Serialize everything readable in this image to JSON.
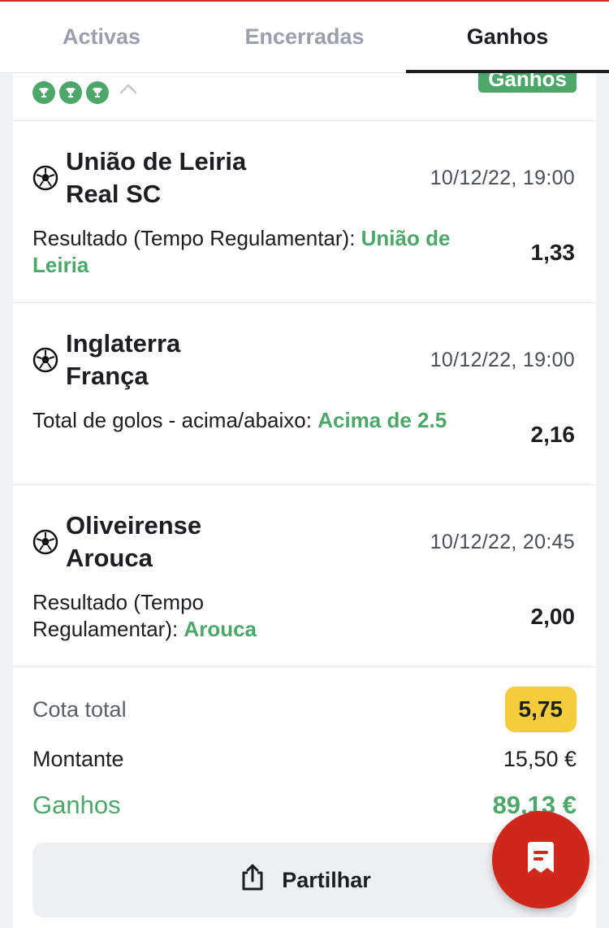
{
  "tabs": [
    {
      "label": "Activas"
    },
    {
      "label": "Encerradas"
    },
    {
      "label": "Ganhos",
      "active": true
    }
  ],
  "bet": {
    "status_badge": "Ganhos",
    "trophy_icons": [
      "trophy-icon",
      "trophy-icon",
      "trophy-icon"
    ],
    "events": [
      {
        "team_home": "União de Leiria",
        "team_away": "Real SC",
        "datetime": "10/12/22, 19:00",
        "market": "Resultado (Tempo Regulamentar): ",
        "pick": "União de Leiria",
        "odd": "1,33"
      },
      {
        "team_home": "Inglaterra",
        "team_away": "França",
        "datetime": "10/12/22, 19:00",
        "market": "Total de golos - acima/abaixo: ",
        "pick": "Acima de 2.5",
        "odd": "2,16"
      },
      {
        "team_home": "Oliveirense",
        "team_away": "Arouca",
        "datetime": "10/12/22, 20:45",
        "market": "Resultado (Tempo Regulamentar): ",
        "pick": "Arouca",
        "odd": "2,00"
      }
    ],
    "summary": {
      "total_odd_label": "Cota total",
      "total_odd_value": "5,75",
      "stake_label": "Montante",
      "stake_value": "15,50 €",
      "winnings_label": "Ganhos",
      "winnings_value": "89,13 €"
    },
    "share_label": "Partilhar"
  },
  "colors": {
    "accent_green": "#4ea76a",
    "odd_badge_yellow": "#f5cd3c",
    "fab_red": "#d0271d",
    "top_line_red": "#d32f2f"
  }
}
